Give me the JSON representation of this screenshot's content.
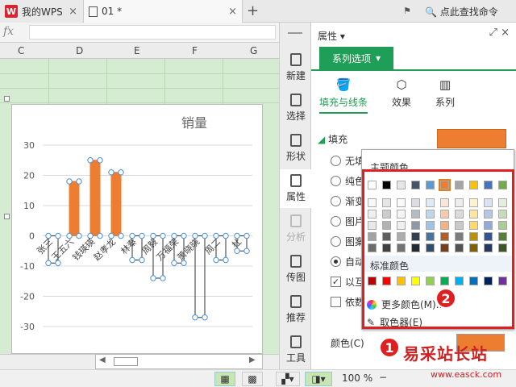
{
  "tabs": [
    {
      "label": "我的WPS"
    },
    {
      "label": "01 *"
    }
  ],
  "search": {
    "text": "点此查找命令"
  },
  "formula": {
    "fx": "fx"
  },
  "columns": [
    "C",
    "D",
    "E",
    "F",
    "G"
  ],
  "chart_data": {
    "type": "bar",
    "title": "销量",
    "categories": [
      "张三",
      "王五六",
      "钱瑛瑛",
      "赵孝龙",
      "林秦",
      "周毅",
      "万福荣",
      "萧晓晓",
      "周二",
      "杜"
    ],
    "values": [
      -9,
      18,
      25,
      21,
      -8,
      -14,
      -9,
      -27,
      -8,
      -5
    ],
    "ylim": [
      -30,
      30
    ],
    "yticks": [
      30,
      20,
      10,
      0,
      -10,
      -20,
      -30
    ],
    "grid": true,
    "colors": {
      "positive": "#ed7d31"
    }
  },
  "tools": [
    {
      "label": "新建",
      "icon": "document-new-icon"
    },
    {
      "label": "选择",
      "icon": "select-icon"
    },
    {
      "label": "形状",
      "icon": "shape-icon"
    },
    {
      "label": "属性",
      "icon": "properties-icon"
    },
    {
      "label": "分析",
      "icon": "analysis-icon"
    },
    {
      "label": "传图",
      "icon": "upload-image-icon"
    },
    {
      "label": "推荐",
      "icon": "recommend-icon"
    },
    {
      "label": "工具",
      "icon": "toolbox-icon"
    }
  ],
  "panel": {
    "title": "属性 ▾",
    "series_option": "系列选项",
    "subtabs": [
      "填充与线条",
      "效果",
      "系列"
    ],
    "fill_section": "填充",
    "options": [
      {
        "label": "无填",
        "type": "radio",
        "checked": false
      },
      {
        "label": "纯色",
        "type": "radio",
        "checked": false
      },
      {
        "label": "渐变",
        "type": "radio",
        "checked": false
      },
      {
        "label": "图片",
        "type": "radio",
        "checked": false
      },
      {
        "label": "图案",
        "type": "radio",
        "checked": false
      },
      {
        "label": "自动",
        "type": "radio",
        "checked": true
      },
      {
        "label": "以互",
        "type": "checkbox",
        "checked": true
      },
      {
        "label": "依数",
        "type": "checkbox",
        "checked": false
      }
    ],
    "color_label": "颜色(C)",
    "accent": "#1f9e57",
    "fill_color": "#ed7d31"
  },
  "popup": {
    "theme_title": "主题颜色",
    "standard_title": "标准颜色",
    "more_colors": "更多颜色(M)...",
    "eyedropper": "取色器(E)",
    "theme_row": [
      "#ffffff",
      "#000000",
      "#e7e6e6",
      "#44546a",
      "#5b9bd5",
      "#ed7d31",
      "#a5a5a5",
      "#ffc000",
      "#4472c4",
      "#70ad47"
    ],
    "standard_row": [
      "#c00000",
      "#ff0000",
      "#ffc000",
      "#ffff00",
      "#92d050",
      "#00b050",
      "#00b0f0",
      "#0070c0",
      "#002060",
      "#7030a0"
    ]
  },
  "annotations": {
    "badge1": "1",
    "badge2": "2"
  },
  "status": {
    "zoom": "100 %"
  },
  "watermark": {
    "text": "易采站长站",
    "url": "www.easck.com"
  }
}
